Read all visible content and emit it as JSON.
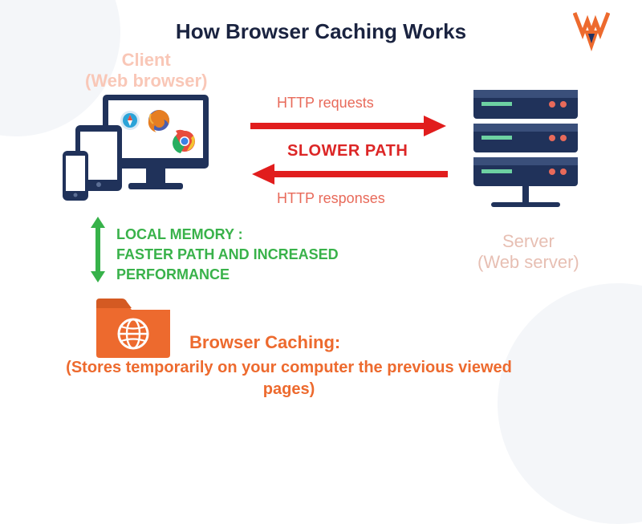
{
  "title": "How Browser Caching Works",
  "client": {
    "line1": "Client",
    "line2": "(Web browser)"
  },
  "http_requests": "HTTP requests",
  "slower_path": "SLOWER PATH",
  "http_responses": "HTTP responses",
  "server": {
    "line1": "Server",
    "line2": "(Web server)"
  },
  "local_memory": {
    "line1": "LOCAL MEMORY :",
    "line2": "FASTER PATH AND INCREASED",
    "line3": "PERFORMANCE"
  },
  "caching": {
    "title": "Browser Caching:",
    "desc": "(Stores temporarily on your computer the previous viewed pages)"
  },
  "icons": {
    "logo": "W-logo",
    "devices": "client-devices",
    "server_rack": "server-rack",
    "folder_globe": "folder-globe",
    "safari": "safari",
    "firefox": "firefox",
    "chrome": "chrome"
  },
  "colors": {
    "title": "#1a2340",
    "client_label": "#f9c7b7",
    "http_text": "#e86a5a",
    "slower": "#dc2626",
    "green": "#39b24a",
    "orange": "#ed6a2e",
    "server_label": "#e7bfb3",
    "monitor": "#20325a",
    "arrow_red": "#e11d1d",
    "arrow_green": "#37b24a"
  }
}
